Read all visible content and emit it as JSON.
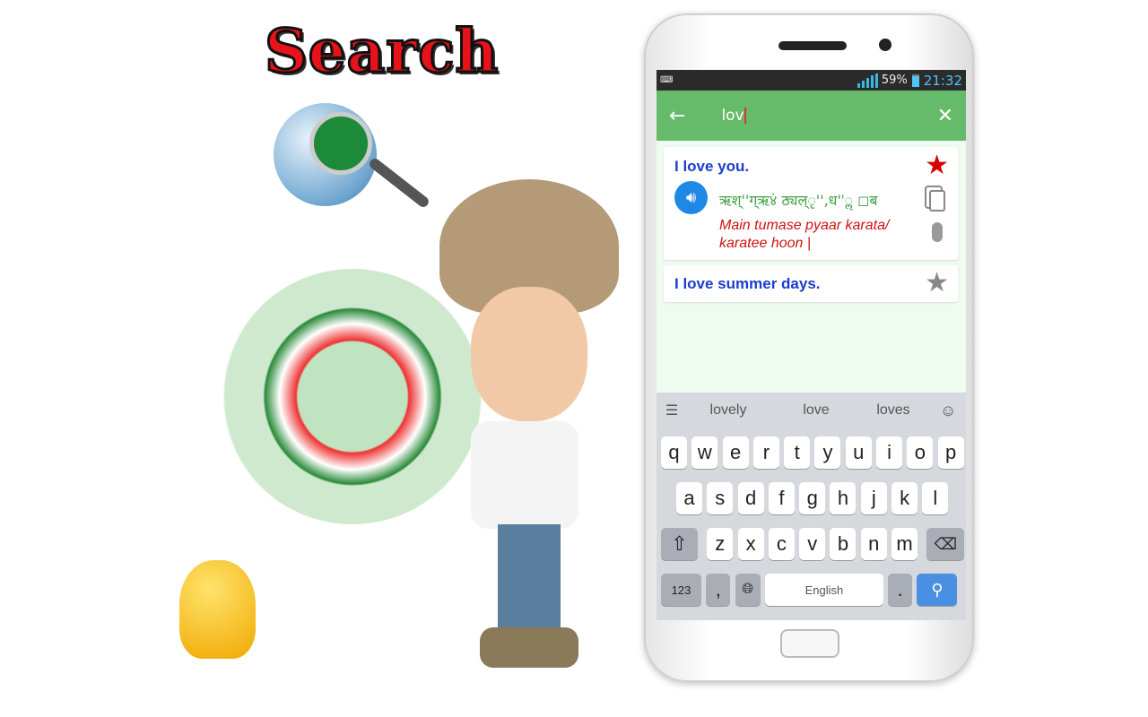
{
  "headline": "Search",
  "status": {
    "battery": "59%",
    "time": "21:32"
  },
  "appbar": {
    "query": "lov"
  },
  "results": [
    {
      "phrase": "I love you.",
      "transliteration_native": "ऋश्''ग्ऋ४ं ठ्यल्ृ'',ध''ॢ ◻ब",
      "romanized": "Main tumase pyaar karata/ karatee hoon |",
      "favorite": true
    },
    {
      "phrase": "I love summer days.",
      "favorite": false
    }
  ],
  "keyboard": {
    "suggestions": [
      "lovely",
      "love",
      "loves"
    ],
    "row1": [
      "q",
      "w",
      "e",
      "r",
      "t",
      "y",
      "u",
      "i",
      "o",
      "p"
    ],
    "row2": [
      "a",
      "s",
      "d",
      "f",
      "g",
      "h",
      "j",
      "k",
      "l"
    ],
    "row3": [
      "z",
      "x",
      "c",
      "v",
      "b",
      "n",
      "m"
    ],
    "numbers_key": "123",
    "comma": ",",
    "period": ".",
    "space_label": "English"
  },
  "colors": {
    "appbar": "#66bb6a",
    "phrase": "#1b3ccf",
    "romanized": "#d01010",
    "favorite_on": "#d50000",
    "search_key": "#4a90e2"
  }
}
